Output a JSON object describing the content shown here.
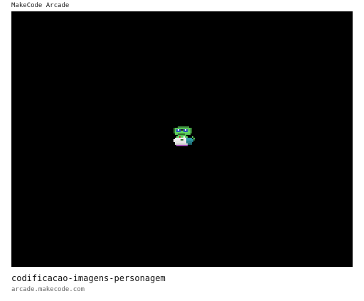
{
  "app": {
    "title": "MakeCode Arcade"
  },
  "game": {
    "background_color": "#000000",
    "sprite_icon": "turtle-character-icon"
  },
  "card": {
    "title": "codificacao-imagens-personagem",
    "domain": "arcade.makecode.com"
  }
}
